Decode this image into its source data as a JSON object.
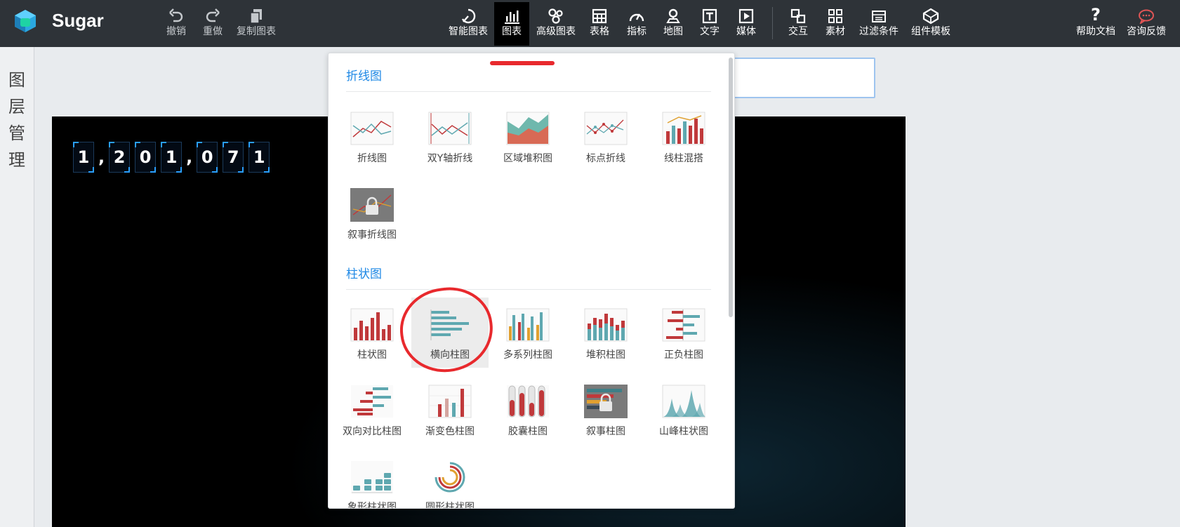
{
  "app": {
    "brand": "Sugar"
  },
  "toolbar_left": [
    {
      "label": "撤销",
      "icon": "undo-icon"
    },
    {
      "label": "重做",
      "icon": "redo-icon"
    },
    {
      "label": "复制图表",
      "icon": "copy-icon"
    }
  ],
  "toolbar_main": [
    {
      "label": "智能图表",
      "icon": "smart-chart-icon"
    },
    {
      "label": "图表",
      "icon": "bar-chart-icon",
      "active": true
    },
    {
      "label": "高级图表",
      "icon": "advanced-chart-icon"
    },
    {
      "label": "表格",
      "icon": "table-icon"
    },
    {
      "label": "指标",
      "icon": "gauge-icon"
    },
    {
      "label": "地图",
      "icon": "map-pin-icon"
    },
    {
      "label": "文字",
      "icon": "text-icon"
    },
    {
      "label": "媒体",
      "icon": "media-play-icon"
    },
    {
      "label": "交互",
      "icon": "interaction-icon"
    },
    {
      "label": "素材",
      "icon": "assets-grid-icon"
    },
    {
      "label": "过滤条件",
      "icon": "filter-icon"
    },
    {
      "label": "组件模板",
      "icon": "template-icon"
    }
  ],
  "toolbar_right": [
    {
      "label": "帮助文档",
      "icon": "help-icon"
    },
    {
      "label": "咨询反馈",
      "icon": "feedback-chat-icon"
    }
  ],
  "left_panel": {
    "title": "图层管理",
    "chars": [
      "图",
      "层",
      "管",
      "理"
    ]
  },
  "counter": {
    "chars": [
      "1",
      ",",
      "2",
      "0",
      "1",
      ",",
      "0",
      "7",
      "1"
    ]
  },
  "dropdown": {
    "sections": [
      {
        "title": "折线图",
        "items": [
          "折线图",
          "双Y轴折线",
          "区域堆积图",
          "标点折线",
          "线柱混搭",
          "叙事折线图"
        ]
      },
      {
        "title": "柱状图",
        "items": [
          "柱状图",
          "横向柱图",
          "多系列柱图",
          "堆积柱图",
          "正负柱图",
          "双向对比柱图",
          "渐变色柱图",
          "胶囊柱图",
          "叙事柱图",
          "山峰柱状图",
          "象形柱状图",
          "圆形柱状图"
        ]
      }
    ]
  },
  "colors": {
    "accent": "#1e88e5",
    "topbar": "#2e3338",
    "annotation": "#e8292d",
    "bar_red": "#c0393b",
    "bar_teal": "#5fa8b0"
  }
}
